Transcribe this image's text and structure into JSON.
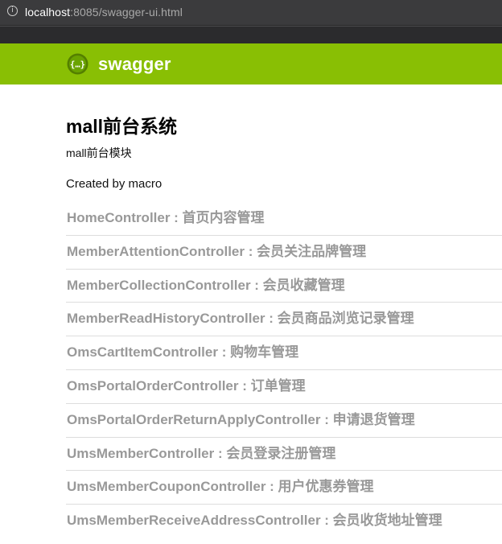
{
  "browser": {
    "info_icon": "info-icon",
    "url_host": "localhost",
    "url_rest": ":8085/swagger-ui.html"
  },
  "header": {
    "logo_icon": "swagger-logo-icon",
    "logo_text": "swagger",
    "bg_color": "#89bf04"
  },
  "info": {
    "title": "mall前台系统",
    "description": "mall前台模块",
    "created_by": "Created by macro"
  },
  "resources": [
    {
      "label": "HomeController : 首页内容管理"
    },
    {
      "label": "MemberAttentionController : 会员关注品牌管理"
    },
    {
      "label": "MemberCollectionController : 会员收藏管理"
    },
    {
      "label": "MemberReadHistoryController : 会员商品浏览记录管理"
    },
    {
      "label": "OmsCartItemController : 购物车管理"
    },
    {
      "label": "OmsPortalOrderController : 订单管理"
    },
    {
      "label": "OmsPortalOrderReturnApplyController : 申请退货管理"
    },
    {
      "label": "UmsMemberController : 会员登录注册管理"
    },
    {
      "label": "UmsMemberCouponController : 用户优惠券管理"
    },
    {
      "label": "UmsMemberReceiveAddressController : 会员收货地址管理"
    }
  ]
}
